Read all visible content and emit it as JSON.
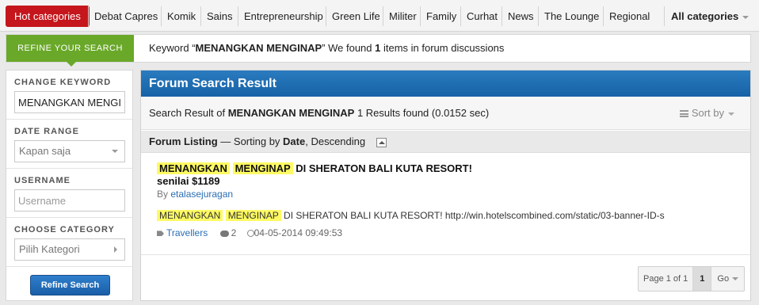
{
  "categories": {
    "hot": "Hot categories",
    "items": [
      "Debat Capres",
      "Komik",
      "Sains",
      "Entrepreneurship",
      "Green Life",
      "Militer",
      "Family",
      "Curhat",
      "News",
      "The Lounge",
      "Regional"
    ],
    "all": "All categories"
  },
  "keyword_bar": {
    "refine_tab": "REFINE YOUR SEARCH",
    "prefix": "Keyword “",
    "keyword": "MENANGKAN MENGINAP",
    "middle": "” We found ",
    "count": "1",
    "suffix": " items in forum discussions"
  },
  "sidebar": {
    "change_keyword_label": "CHANGE KEYWORD",
    "keyword_value": "MENANGKAN MENGINAP",
    "date_range_label": "DATE RANGE",
    "date_range_value": "Kapan saja",
    "username_label": "USERNAME",
    "username_placeholder": "Username",
    "category_label": "CHOOSE CATEGORY",
    "category_value": "Pilih Kategori",
    "refine_button": "Refine Search"
  },
  "panel": {
    "title": "Forum Search Result",
    "summary_prefix": "Search Result of ",
    "summary_keyword": "MENANGKAN MENGINAP",
    "summary_suffix": " 1 Results found (0.0152 sec)",
    "sort_by": "Sort by",
    "listing_title": "Forum Listing",
    "listing_mid": " — Sorting by ",
    "listing_sort": "Date",
    "listing_order": ", Descending"
  },
  "result": {
    "title_hl1": "MENANGKAN",
    "title_hl2": "MENGINAP",
    "title_rest": "DI SHERATON BALI KUTA RESORT!",
    "title_line2": "senilai $1189",
    "by_prefix": "By ",
    "author": "etalasejuragan",
    "snippet_hl1": "MENANGKAN",
    "snippet_hl2": "MENGINAP",
    "snippet_rest": " DI SHERATON BALI KUTA RESORT! http://win.hotelscombined.com/static/03-banner-ID-s",
    "category": "Travellers",
    "comments": "2",
    "datetime": "04-05-2014 09:49:53"
  },
  "pager": {
    "label": "Page 1 of 1",
    "current": "1",
    "go": "Go"
  }
}
